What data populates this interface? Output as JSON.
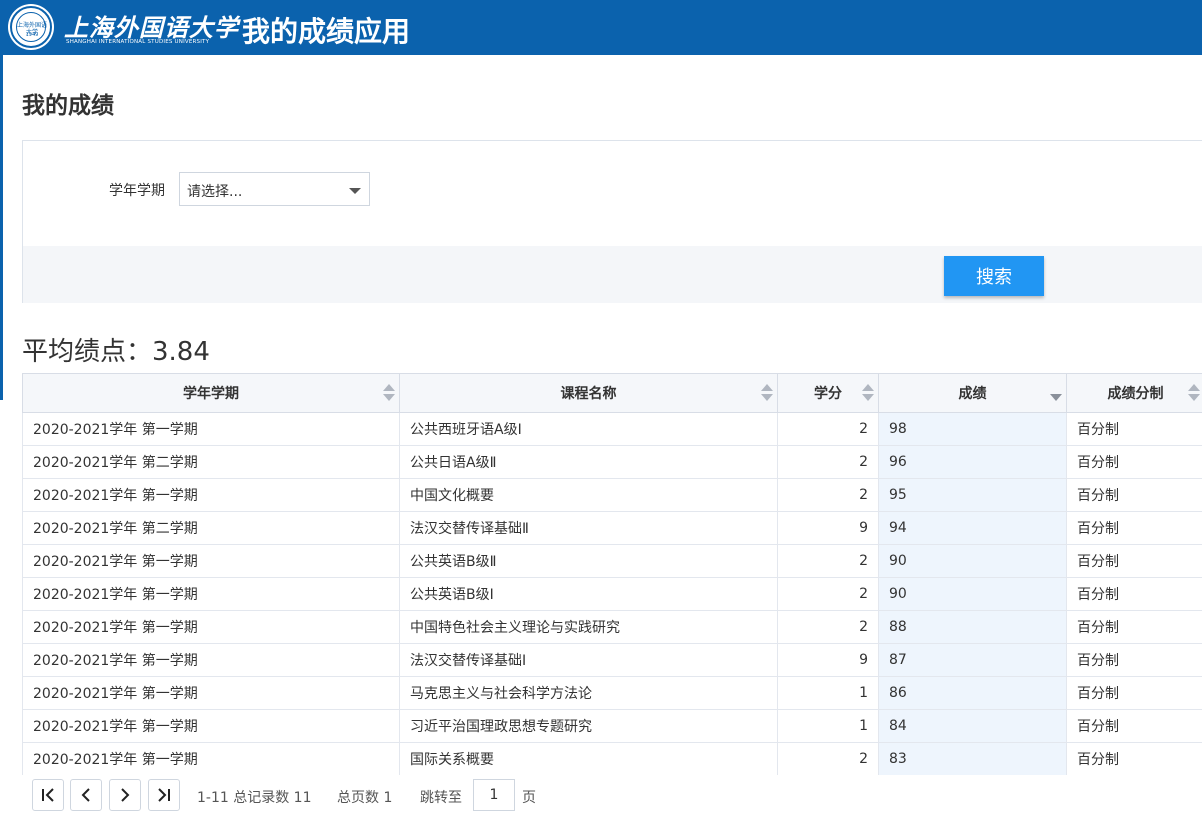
{
  "header": {
    "university_cn": "上海外国语大学",
    "university_en": "SHANGHAI INTERNATIONAL STUDIES UNIVERSITY",
    "seal_text": "上海外国语大学",
    "seal_year": "1949",
    "app_title": "我的成绩应用"
  },
  "page_title": "我的成绩",
  "filter": {
    "label": "学年学期",
    "select_value": "请选择..."
  },
  "search_button": "搜索",
  "gpa": "平均绩点：3.84",
  "table": {
    "columns": [
      "学年学期",
      "课程名称",
      "学分",
      "成绩",
      "成绩分制"
    ],
    "sorted_column": "成绩",
    "sort_direction": "descending",
    "rows": [
      [
        "2020-2021学年 第一学期",
        "公共西班牙语A级Ⅰ",
        "2",
        "98",
        "百分制"
      ],
      [
        "2020-2021学年 第二学期",
        "公共日语A级Ⅱ",
        "2",
        "96",
        "百分制"
      ],
      [
        "2020-2021学年 第一学期",
        "中国文化概要",
        "2",
        "95",
        "百分制"
      ],
      [
        "2020-2021学年 第二学期",
        "法汉交替传译基础Ⅱ",
        "9",
        "94",
        "百分制"
      ],
      [
        "2020-2021学年 第一学期",
        "公共英语B级Ⅱ",
        "2",
        "90",
        "百分制"
      ],
      [
        "2020-2021学年 第一学期",
        "公共英语B级Ⅰ",
        "2",
        "90",
        "百分制"
      ],
      [
        "2020-2021学年 第一学期",
        "中国特色社会主义理论与实践研究",
        "2",
        "88",
        "百分制"
      ],
      [
        "2020-2021学年 第一学期",
        "法汉交替传译基础Ⅰ",
        "9",
        "87",
        "百分制"
      ],
      [
        "2020-2021学年 第一学期",
        "马克思主义与社会科学方法论",
        "1",
        "86",
        "百分制"
      ],
      [
        "2020-2021学年 第一学期",
        "习近平治国理政思想专题研究",
        "1",
        "84",
        "百分制"
      ],
      [
        "2020-2021学年 第一学期",
        "国际关系概要",
        "2",
        "83",
        "百分制"
      ]
    ]
  },
  "pager": {
    "first_icon": "first-page-icon",
    "prev_icon": "prev-page-icon",
    "next_icon": "next-page-icon",
    "last_icon": "last-page-icon",
    "range": "1-11 总记录数 11",
    "total_pages": "总页数 1",
    "jump_label": "跳转至",
    "jump_value": "1",
    "page_unit": "页"
  },
  "colors": {
    "brand": "#0b62ad",
    "button": "#2196f3",
    "sorted_column_bg": "#eef5fd"
  }
}
